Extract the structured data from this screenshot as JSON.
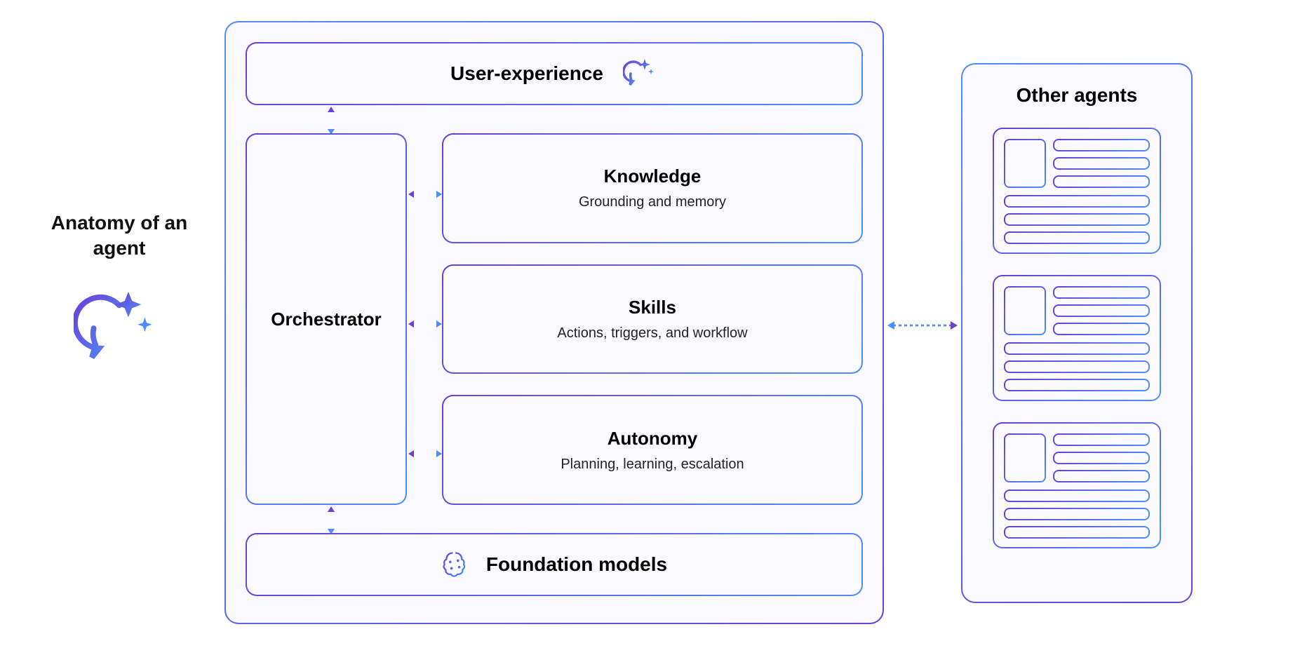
{
  "title": "Anatomy of an agent",
  "main": {
    "userExperience": "User-experience",
    "orchestrator": "Orchestrator",
    "modules": [
      {
        "title": "Knowledge",
        "subtitle": "Grounding and memory"
      },
      {
        "title": "Skills",
        "subtitle": "Actions, triggers, and workflow"
      },
      {
        "title": "Autonomy",
        "subtitle": "Planning, learning, escalation"
      }
    ],
    "foundation": "Foundation models"
  },
  "otherAgents": {
    "title": "Other agents"
  },
  "colors": {
    "gradientStart": "#6b3fd6",
    "gradientEnd": "#4f8ef7",
    "panelBg": "#fbfbff"
  }
}
